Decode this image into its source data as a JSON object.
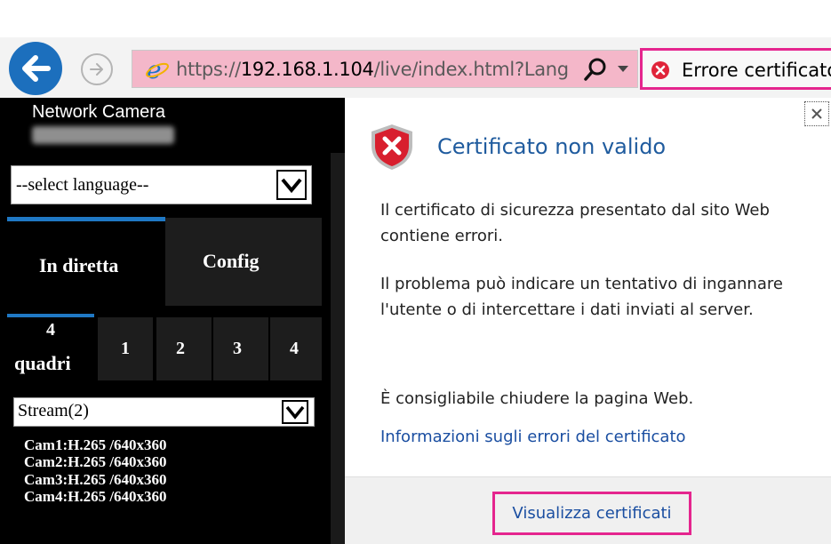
{
  "browser": {
    "url_prefix": "https://",
    "url_host": "192.168.1.104",
    "url_path": "/live/index.html?Lang",
    "cert_error_label": "Errore certificato",
    "address_bar_color": "#f4b7c9",
    "highlight_color": "#e5258e",
    "icons": [
      "back-arrow-icon",
      "forward-arrow-icon",
      "ie-logo-icon",
      "search-icon",
      "chevron-down-icon",
      "error-circle-icon"
    ]
  },
  "camera_panel": {
    "title": "Network Camera",
    "language_select": "--select language--",
    "tabs": [
      {
        "label": "In diretta",
        "active": true
      },
      {
        "label": "Config",
        "active": false
      }
    ],
    "view_buttons": {
      "quad_number": "4",
      "quad_label": "quadri",
      "cameras": [
        "1",
        "2",
        "3",
        "4"
      ]
    },
    "stream_select": "Stream(2)",
    "cam_info": [
      "Cam1:H.265 /640x360",
      "Cam2:H.265 /640x360",
      "Cam3:H.265 /640x360",
      "Cam4:H.265 /640x360"
    ]
  },
  "popup": {
    "title": "Certificato non valido",
    "p1": "Il certificato di sicurezza presentato dal sito Web contiene errori.",
    "p2": "Il problema può indicare un tentativo di ingannare l'utente o di intercettare i dati inviati al server.",
    "p3": "È consigliabile chiudere la pagina Web.",
    "link": "Informazioni sugli errori del certificato",
    "button": "Visualizza certificati",
    "close_icon": "close-icon",
    "shield_icon": "shield-error-icon"
  }
}
